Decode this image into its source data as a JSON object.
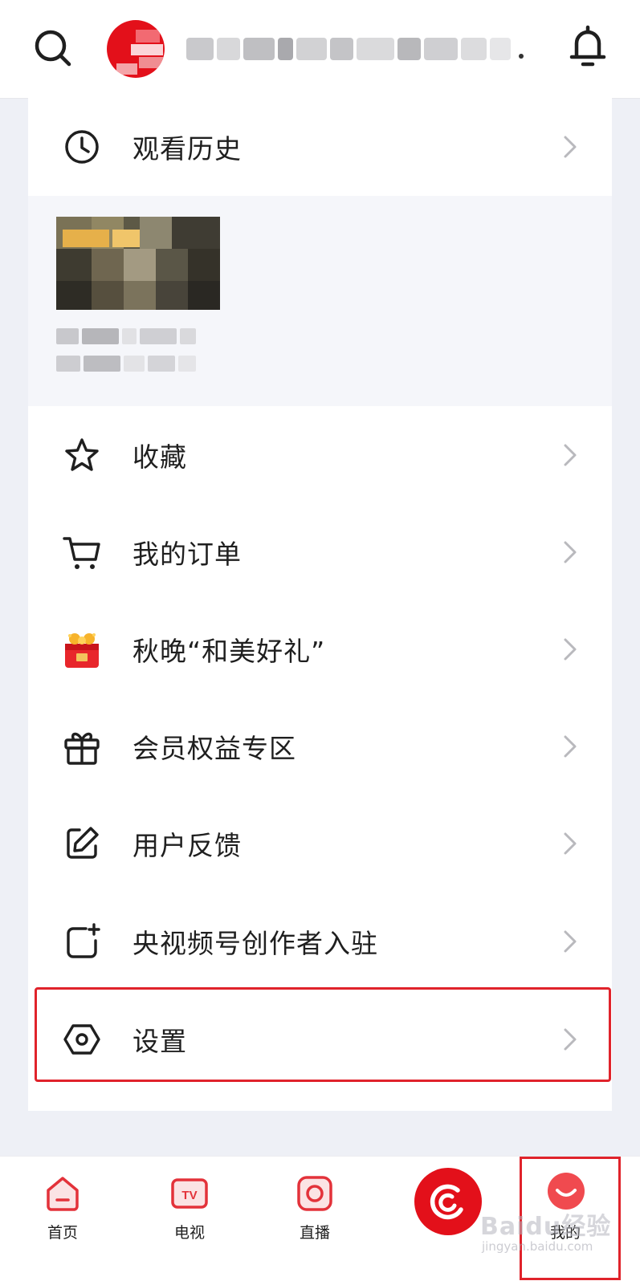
{
  "header": {
    "search_icon": "search-icon",
    "bell_icon": "bell-icon",
    "username_masked": "手机用户182****9592..."
  },
  "menu": {
    "history": {
      "label": "观看历史",
      "icon": "clock-icon"
    },
    "favorites": {
      "label": "收藏",
      "icon": "star-icon"
    },
    "orders": {
      "label": "我的订单",
      "icon": "cart-icon"
    },
    "gift": {
      "label": "秋晚“和美好礼”",
      "icon": "gift-box-icon"
    },
    "member": {
      "label": "会员权益专区",
      "icon": "present-icon"
    },
    "feedback": {
      "label": "用户反馈",
      "icon": "edit-icon"
    },
    "creator": {
      "label": "央视频号创作者入驻",
      "icon": "add-square-icon"
    },
    "settings": {
      "label": "设置",
      "icon": "hexagon-settings-icon"
    }
  },
  "tabbar": {
    "home": {
      "label": "首页",
      "icon": "home-icon"
    },
    "tv": {
      "label": "电视",
      "icon": "tv-icon"
    },
    "live": {
      "label": "直播",
      "icon": "live-icon"
    },
    "center": {
      "icon": "cctv-logo-icon"
    },
    "me": {
      "label": "我的",
      "icon": "smile-face-icon"
    }
  },
  "watermark": {
    "brand": "Baidu经验",
    "url": "jingyan.baidu.com"
  },
  "colors": {
    "accent": "#e3101a",
    "highlight_box": "#e0232b",
    "background": "#eef0f6"
  }
}
